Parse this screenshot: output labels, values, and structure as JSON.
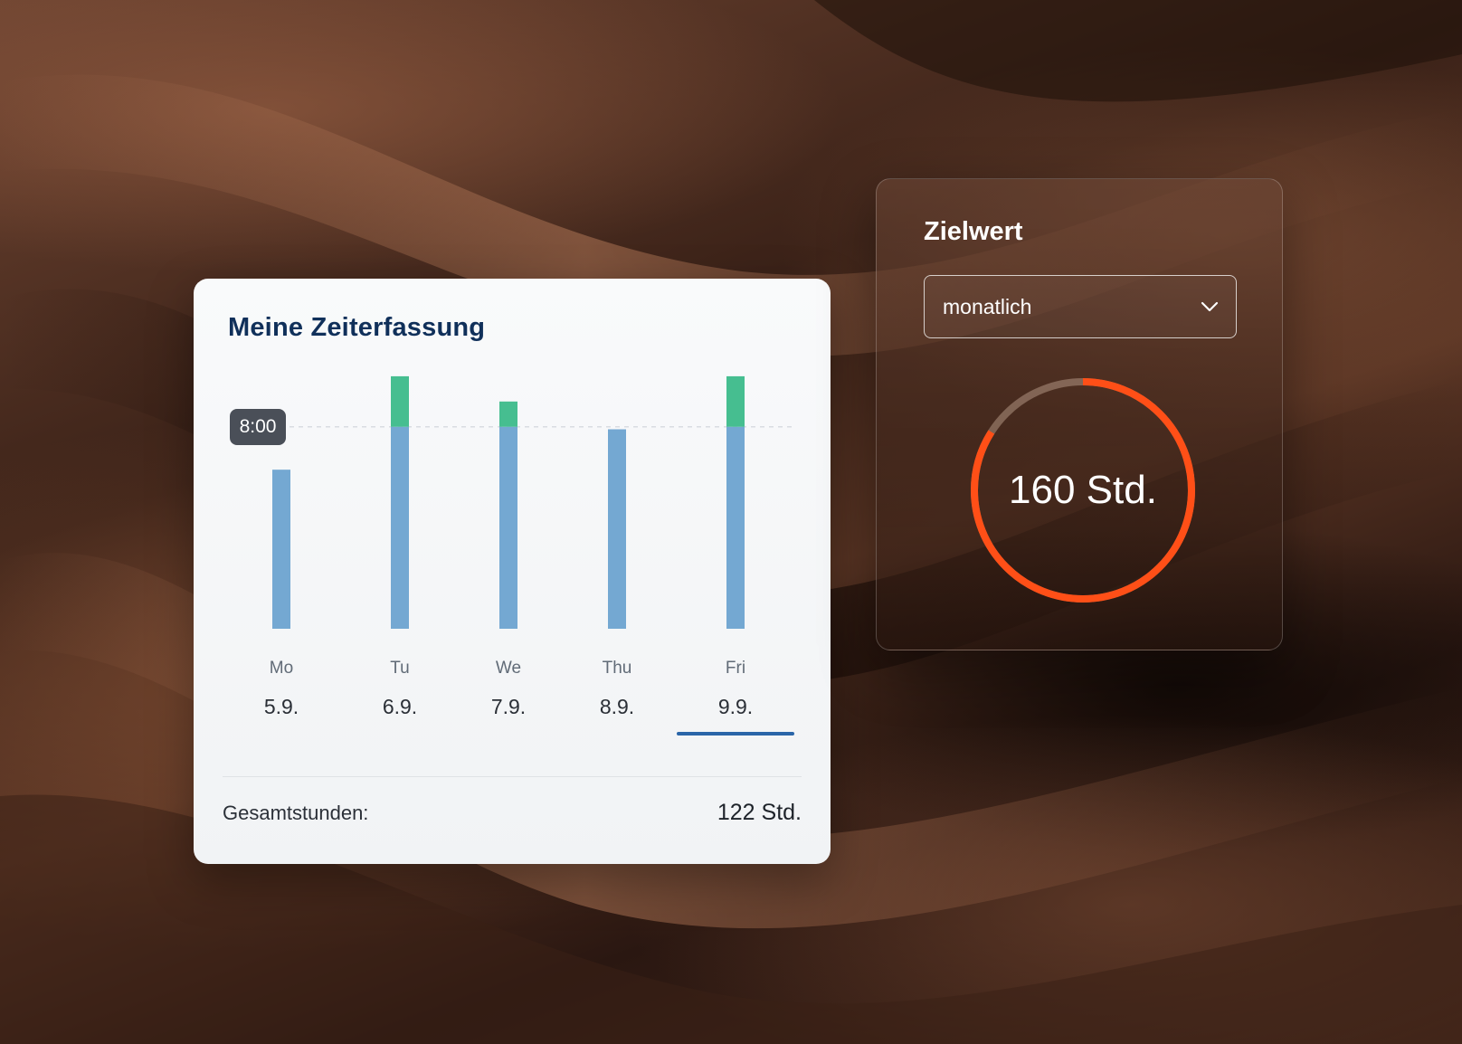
{
  "colors": {
    "bar_base": "#74a8d2",
    "bar_overtime": "#46be90",
    "reference_line": "#d9dde2",
    "underline": "#2a65a8",
    "gauge_track": "rgba(200,170,150,0.45)",
    "gauge_fill": "#ff4f17"
  },
  "time_card": {
    "title": "Meine Zeiterfassung",
    "reference_badge": "8:00",
    "total_label": "Gesamtstunden:",
    "total_value": "122 Std.",
    "selected_day_index": 4
  },
  "chart_data": {
    "type": "bar",
    "stacked": true,
    "categories": [
      "Mo",
      "Tu",
      "We",
      "Thu",
      "Fri"
    ],
    "dates": [
      "5.9.",
      "6.9.",
      "7.9.",
      "8.9.",
      "9.9."
    ],
    "reference_line": 8,
    "ylim": [
      0,
      11.0
    ],
    "series": [
      {
        "values": [
          6.3,
          8.0,
          8.0,
          7.9,
          8.0
        ]
      },
      {
        "values": [
          0,
          2.0,
          1.0,
          0,
          2.0
        ]
      }
    ],
    "grid": false
  },
  "goal_card": {
    "title": "Zielwert",
    "period_select": {
      "value": "monatlich",
      "icon": "chevron-down-icon"
    },
    "gauge_value": "160 Std.",
    "gauge_progress": 0.84
  }
}
